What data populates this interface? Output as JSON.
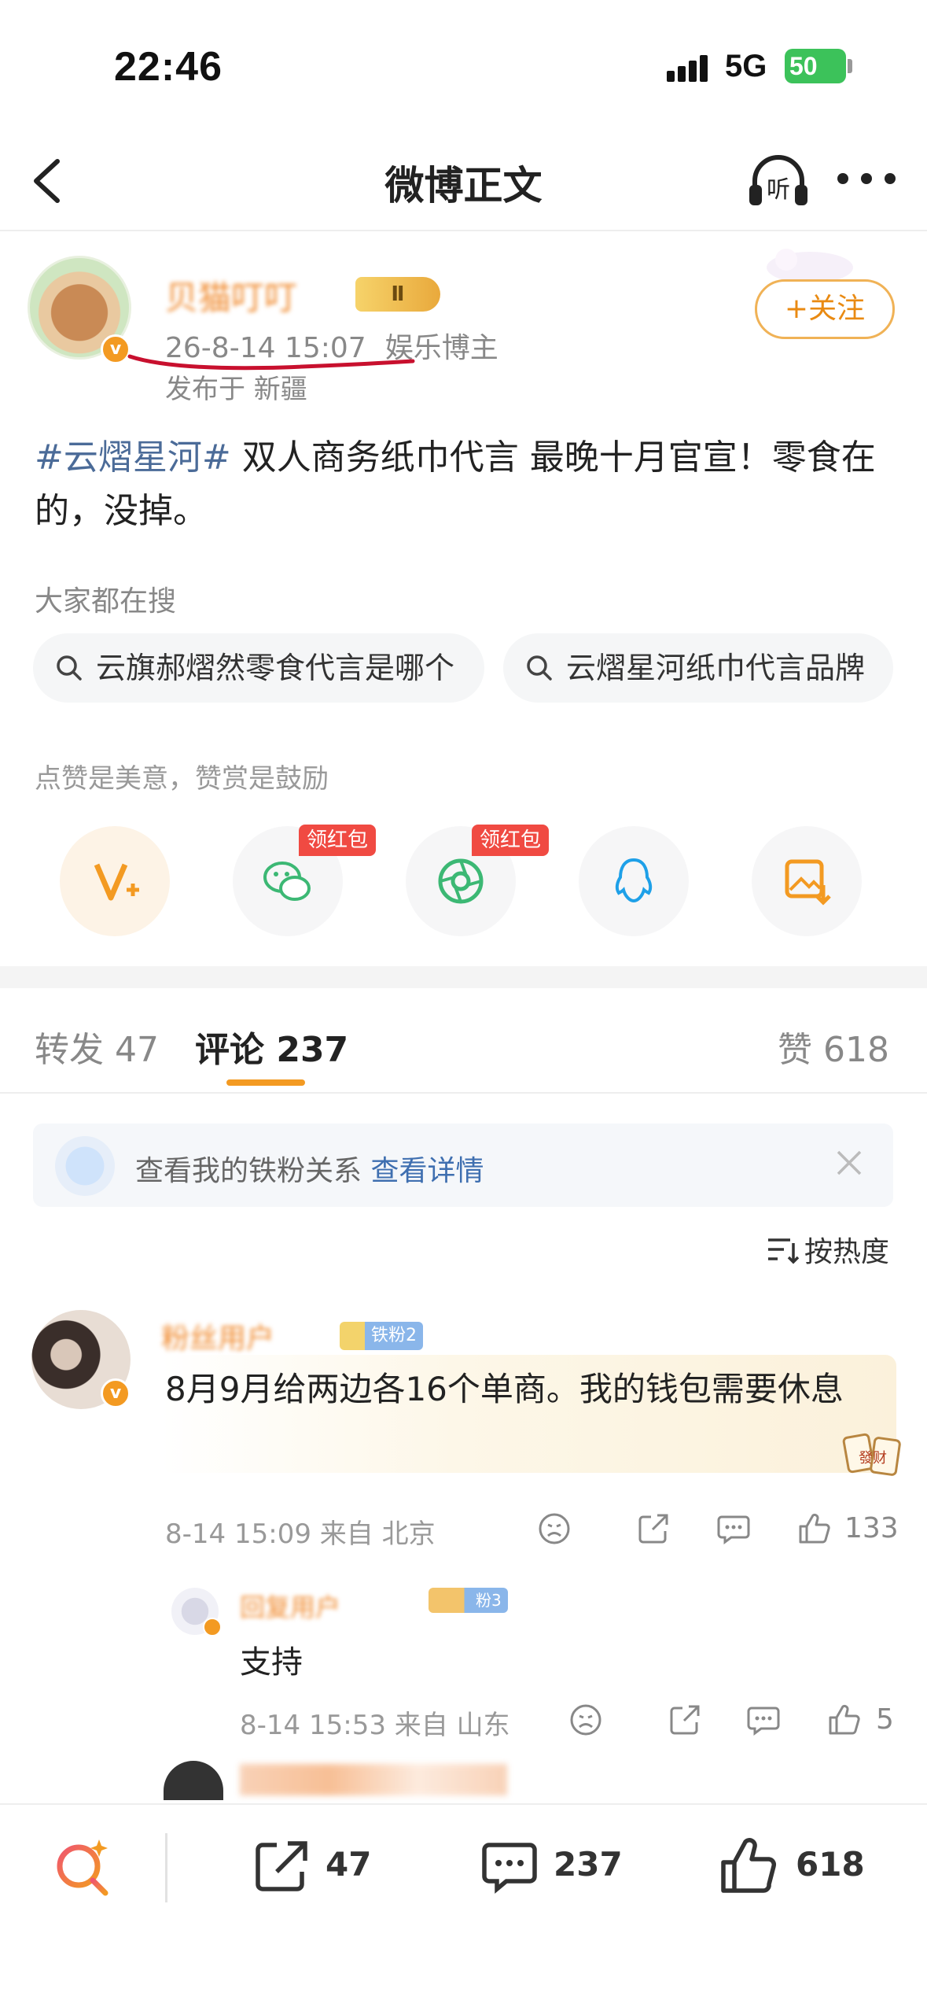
{
  "status_bar": {
    "time": "22:46",
    "network": "5G",
    "battery": "50"
  },
  "nav": {
    "title": "微博正文",
    "listen_label": "听"
  },
  "post": {
    "username": "贝猫叮叮",
    "level_badge": "Ⅱ",
    "time": "26-8-14 15:07",
    "user_type": "娱乐博主",
    "location": "发布于 新疆",
    "follow_label": "+关注",
    "topic": "#云熠星河#",
    "text": " 双人商务纸巾代言 最晚十月官宣！零食在的，没掉。"
  },
  "search": {
    "heading": "大家都在搜",
    "chips": [
      "云旗郝熠然零食代言是哪个",
      "云熠星河纸巾代言品牌"
    ]
  },
  "support": {
    "caption": "点赞是美意，赞赏是鼓励",
    "hongbao_label": "领红包"
  },
  "tabs": {
    "repost_label": "转发",
    "repost_count": "47",
    "comment_label": "评论",
    "comment_count": "237",
    "like_label": "赞",
    "like_count": "618"
  },
  "fan_banner": {
    "text": "查看我的铁粉关系",
    "link": "查看详情"
  },
  "sort": {
    "label": "按热度"
  },
  "comments": [
    {
      "name": "粉丝用户",
      "badge": "铁粉2",
      "text": "8月9月给两边各16个单商。我的钱包需要休息",
      "time": "8-14 15:09",
      "from": "来自 北京",
      "likes": "133",
      "facai": "發财"
    }
  ],
  "replies": [
    {
      "name": "回复用户",
      "badge": "粉3",
      "text": "支持",
      "time": "8-14 15:53",
      "from": "来自 山东",
      "likes": "5"
    }
  ],
  "bottom_bar": {
    "repost_count": "47",
    "comment_count": "237",
    "like_count": "618"
  },
  "colors": {
    "accent": "#f39a22",
    "link": "#4b6b98",
    "hongbao": "#f04a42",
    "wechat": "#3cb874"
  }
}
